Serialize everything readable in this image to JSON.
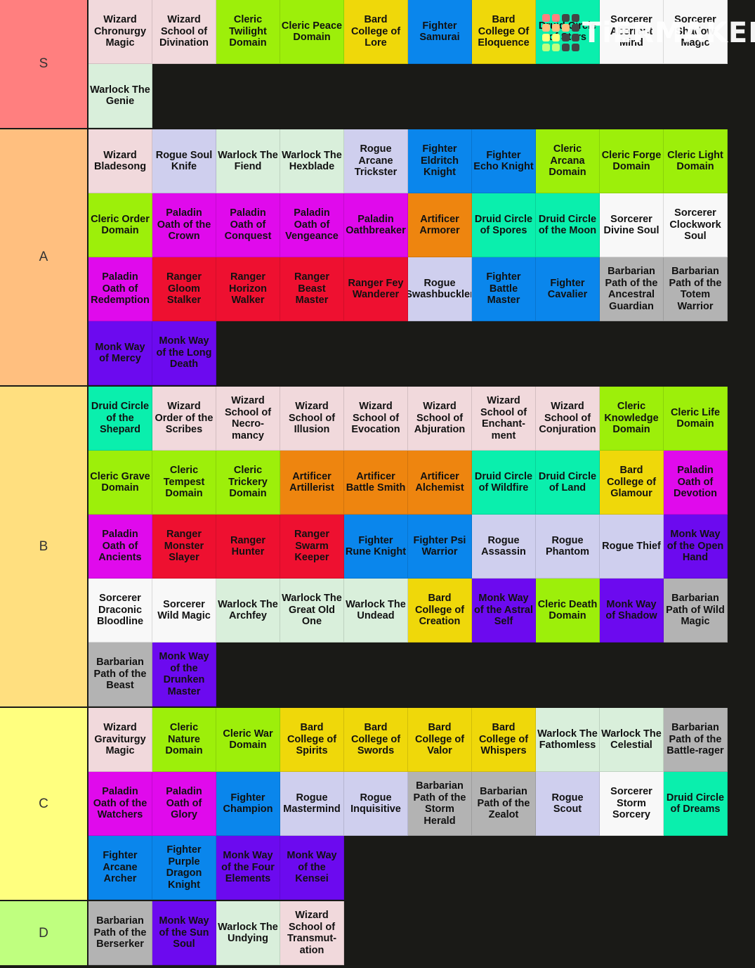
{
  "colors": {
    "wizard": "#f1d9dc",
    "rogue": "#cfcfee",
    "warlock": "#d9efdb",
    "cleric": "#9def0a",
    "bard": "#efd80a",
    "fighter": "#0a86ec",
    "druid": "#0aefad",
    "sorcerer": "#f8f8f8",
    "paladin": "#e00aec",
    "ranger": "#ee1030",
    "artificer": "#ee850f",
    "barbarian": "#b3b3b3",
    "monk": "#6c0aef"
  },
  "watermark": {
    "text": "TiERMAKER",
    "grid_colors": [
      "#ff7f7f",
      "#ff7f7f",
      "#444",
      "#444",
      "#ffbf7f",
      "#ffbf7f",
      "#ffbf7f",
      "#444",
      "#ffff7f",
      "#ffff7f",
      "#444",
      "#444",
      "#bfff7f",
      "#bfff7f",
      "#444",
      "#444"
    ]
  },
  "tiers": [
    {
      "label": "S",
      "color": "#ff7f7f",
      "items": [
        {
          "name": "Wizard Chronurgy Magic",
          "cls": "wizard"
        },
        {
          "name": "Wizard School of Divination",
          "cls": "wizard"
        },
        {
          "name": "Cleric Twilight Domain",
          "cls": "cleric"
        },
        {
          "name": "Cleric Peace Domain",
          "cls": "cleric"
        },
        {
          "name": "Bard College of Lore",
          "cls": "bard"
        },
        {
          "name": "Fighter Samurai",
          "cls": "fighter"
        },
        {
          "name": "Bard College Of Eloquence",
          "cls": "bard"
        },
        {
          "name": "Druid Circle of Stars",
          "cls": "druid"
        },
        {
          "name": "Sorcerer Aberrant Mind",
          "cls": "sorcerer"
        },
        {
          "name": "Sorcerer Shadow Magic",
          "cls": "sorcerer"
        },
        {
          "name": "Warlock The Genie",
          "cls": "warlock"
        }
      ]
    },
    {
      "label": "A",
      "color": "#ffbf7f",
      "items": [
        {
          "name": "Wizard Bladesong",
          "cls": "wizard"
        },
        {
          "name": "Rogue Soul Knife",
          "cls": "rogue"
        },
        {
          "name": "Warlock The Fiend",
          "cls": "warlock"
        },
        {
          "name": "Warlock The Hexblade",
          "cls": "warlock"
        },
        {
          "name": "Rogue Arcane Trickster",
          "cls": "rogue"
        },
        {
          "name": "Fighter Eldritch Knight",
          "cls": "fighter"
        },
        {
          "name": "Fighter Echo Knight",
          "cls": "fighter"
        },
        {
          "name": "Cleric Arcana Domain",
          "cls": "cleric"
        },
        {
          "name": "Cleric Forge Domain",
          "cls": "cleric"
        },
        {
          "name": "Cleric Light Domain",
          "cls": "cleric"
        },
        {
          "name": "Cleric Order Domain",
          "cls": "cleric"
        },
        {
          "name": "Paladin Oath of the Crown",
          "cls": "paladin"
        },
        {
          "name": "Paladin Oath of Conquest",
          "cls": "paladin"
        },
        {
          "name": "Paladin Oath of Vengeance",
          "cls": "paladin"
        },
        {
          "name": "Paladin Oathbreaker",
          "cls": "paladin"
        },
        {
          "name": "Artificer Armorer",
          "cls": "artificer"
        },
        {
          "name": "Druid Circle of Spores",
          "cls": "druid"
        },
        {
          "name": "Druid Circle of the Moon",
          "cls": "druid"
        },
        {
          "name": "Sorcerer Divine Soul",
          "cls": "sorcerer"
        },
        {
          "name": "Sorcerer Clockwork Soul",
          "cls": "sorcerer"
        },
        {
          "name": "Paladin Oath of Redemption",
          "cls": "paladin"
        },
        {
          "name": "Ranger Gloom Stalker",
          "cls": "ranger"
        },
        {
          "name": "Ranger Horizon Walker",
          "cls": "ranger"
        },
        {
          "name": "Ranger Beast Master",
          "cls": "ranger"
        },
        {
          "name": "Ranger Fey Wanderer",
          "cls": "ranger"
        },
        {
          "name": "Rogue Swashbuckler",
          "cls": "rogue"
        },
        {
          "name": "Fighter Battle Master",
          "cls": "fighter"
        },
        {
          "name": "Fighter Cavalier",
          "cls": "fighter"
        },
        {
          "name": "Barbarian Path of the Ancestral Guardian",
          "cls": "barbarian"
        },
        {
          "name": "Barbarian Path of the Totem Warrior",
          "cls": "barbarian"
        },
        {
          "name": "Monk Way of Mercy",
          "cls": "monk"
        },
        {
          "name": "Monk Way of the Long Death",
          "cls": "monk"
        }
      ]
    },
    {
      "label": "B",
      "color": "#ffdf7f",
      "items": [
        {
          "name": "Druid Circle of the Shepard",
          "cls": "druid"
        },
        {
          "name": "Wizard Order of the Scribes",
          "cls": "wizard"
        },
        {
          "name": "Wizard School of Necro-mancy",
          "cls": "wizard"
        },
        {
          "name": "Wizard School of Illusion",
          "cls": "wizard"
        },
        {
          "name": "Wizard School of Evocation",
          "cls": "wizard"
        },
        {
          "name": "Wizard School of Abjuration",
          "cls": "wizard"
        },
        {
          "name": "Wizard School of Enchant-ment",
          "cls": "wizard"
        },
        {
          "name": "Wizard School of Conjuration",
          "cls": "wizard"
        },
        {
          "name": "Cleric Knowledge Domain",
          "cls": "cleric"
        },
        {
          "name": "Cleric Life Domain",
          "cls": "cleric"
        },
        {
          "name": "Cleric Grave Domain",
          "cls": "cleric"
        },
        {
          "name": "Cleric Tempest Domain",
          "cls": "cleric"
        },
        {
          "name": "Cleric Trickery Domain",
          "cls": "cleric"
        },
        {
          "name": "Artificer Artillerist",
          "cls": "artificer"
        },
        {
          "name": "Artificer Battle Smith",
          "cls": "artificer"
        },
        {
          "name": "Artificer Alchemist",
          "cls": "artificer"
        },
        {
          "name": "Druid Circle of Wildfire",
          "cls": "druid"
        },
        {
          "name": "Druid Circle of Land",
          "cls": "druid"
        },
        {
          "name": "Bard College of Glamour",
          "cls": "bard"
        },
        {
          "name": "Paladin Oath of Devotion",
          "cls": "paladin"
        },
        {
          "name": "Paladin Oath of Ancients",
          "cls": "paladin"
        },
        {
          "name": "Ranger Monster Slayer",
          "cls": "ranger"
        },
        {
          "name": "Ranger Hunter",
          "cls": "ranger"
        },
        {
          "name": "Ranger Swarm Keeper",
          "cls": "ranger"
        },
        {
          "name": "Fighter Rune Knight",
          "cls": "fighter"
        },
        {
          "name": "Fighter Psi Warrior",
          "cls": "fighter"
        },
        {
          "name": "Rogue Assassin",
          "cls": "rogue"
        },
        {
          "name": "Rogue Phantom",
          "cls": "rogue"
        },
        {
          "name": "Rogue Thief",
          "cls": "rogue"
        },
        {
          "name": "Monk Way of the Open Hand",
          "cls": "monk"
        },
        {
          "name": "Sorcerer Draconic Bloodline",
          "cls": "sorcerer"
        },
        {
          "name": "Sorcerer Wild Magic",
          "cls": "sorcerer"
        },
        {
          "name": "Warlock The Archfey",
          "cls": "warlock"
        },
        {
          "name": "Warlock The Great Old One",
          "cls": "warlock"
        },
        {
          "name": "Warlock The Undead",
          "cls": "warlock"
        },
        {
          "name": "Bard College of Creation",
          "cls": "bard"
        },
        {
          "name": "Monk Way of the Astral Self",
          "cls": "monk"
        },
        {
          "name": "Cleric Death Domain",
          "cls": "cleric"
        },
        {
          "name": "Monk Way of Shadow",
          "cls": "monk"
        },
        {
          "name": "Barbarian Path of Wild Magic",
          "cls": "barbarian"
        },
        {
          "name": "Barbarian Path of the Beast",
          "cls": "barbarian"
        },
        {
          "name": "Monk Way of the Drunken Master",
          "cls": "monk"
        }
      ]
    },
    {
      "label": "C",
      "color": "#ffff7f",
      "items": [
        {
          "name": "Wizard Graviturgy Magic",
          "cls": "wizard"
        },
        {
          "name": "Cleric Nature Domain",
          "cls": "cleric"
        },
        {
          "name": "Cleric War Domain",
          "cls": "cleric"
        },
        {
          "name": "Bard College of Spirits",
          "cls": "bard"
        },
        {
          "name": "Bard College of Swords",
          "cls": "bard"
        },
        {
          "name": "Bard College of Valor",
          "cls": "bard"
        },
        {
          "name": "Bard College of Whispers",
          "cls": "bard"
        },
        {
          "name": "Warlock The Fathomless",
          "cls": "warlock"
        },
        {
          "name": "Warlock The Celestial",
          "cls": "warlock"
        },
        {
          "name": "Barbarian Path of the Battle-rager",
          "cls": "barbarian"
        },
        {
          "name": "Paladin Oath of the Watchers",
          "cls": "paladin"
        },
        {
          "name": "Paladin Oath of Glory",
          "cls": "paladin"
        },
        {
          "name": "Fighter Champion",
          "cls": "fighter"
        },
        {
          "name": "Rogue Mastermind",
          "cls": "rogue"
        },
        {
          "name": "Rogue Inquisitive",
          "cls": "rogue"
        },
        {
          "name": "Barbarian Path of the Storm Herald",
          "cls": "barbarian"
        },
        {
          "name": "Barbarian Path of the Zealot",
          "cls": "barbarian"
        },
        {
          "name": "Rogue Scout",
          "cls": "rogue"
        },
        {
          "name": "Sorcerer Storm Sorcery",
          "cls": "sorcerer"
        },
        {
          "name": "Druid Circle of Dreams",
          "cls": "druid"
        },
        {
          "name": "Fighter Arcane Archer",
          "cls": "fighter"
        },
        {
          "name": "Fighter Purple Dragon Knight",
          "cls": "fighter"
        },
        {
          "name": "Monk Way of the Four Elements",
          "cls": "monk"
        },
        {
          "name": "Monk Way of the Kensei",
          "cls": "monk"
        }
      ]
    },
    {
      "label": "D",
      "color": "#bfff7f",
      "items": [
        {
          "name": "Barbarian Path of the Berserker",
          "cls": "barbarian"
        },
        {
          "name": "Monk Way of the Sun Soul",
          "cls": "monk"
        },
        {
          "name": "Warlock The Undying",
          "cls": "warlock"
        },
        {
          "name": "Wizard School of Transmut-ation",
          "cls": "wizard"
        }
      ]
    }
  ]
}
